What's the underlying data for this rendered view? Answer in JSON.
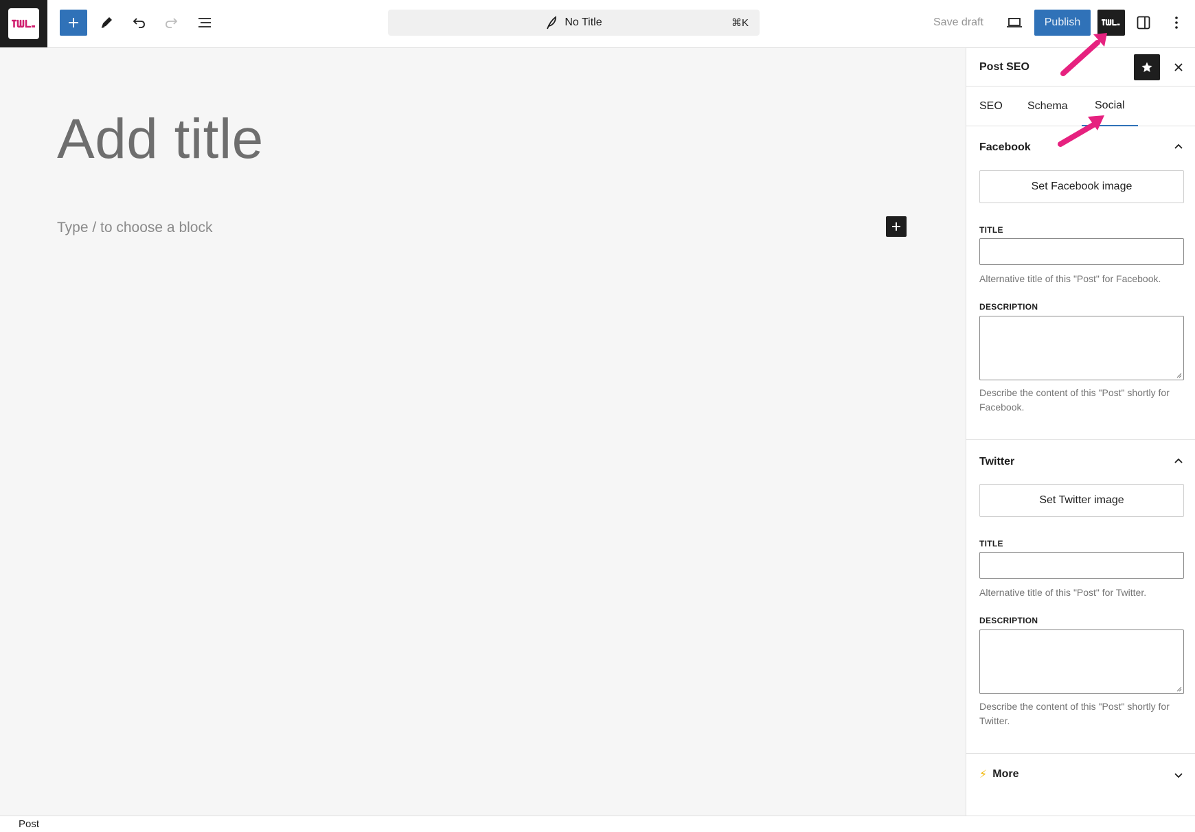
{
  "toolbar": {
    "document_title": "No Title",
    "command_shortcut": "⌘K",
    "save_draft_label": "Save draft",
    "publish_label": "Publish",
    "accent_color": "#3072b8",
    "icons": {
      "logo": "site-logo-icon",
      "add": "plus-icon",
      "tools": "pencil-icon",
      "undo": "undo-icon",
      "redo": "redo-icon",
      "outline": "list-view-icon",
      "view": "laptop-icon",
      "plugin": "seo-plugin-icon",
      "sidebar": "sidebar-icon",
      "options": "more-vertical-icon"
    }
  },
  "editor": {
    "title_placeholder": "Add title",
    "block_placeholder": "Type / to choose a block"
  },
  "sidebar": {
    "title": "Post SEO",
    "tabs": [
      {
        "label": "SEO",
        "active": false
      },
      {
        "label": "Schema",
        "active": false
      },
      {
        "label": "Social",
        "active": true
      }
    ],
    "facebook": {
      "heading": "Facebook",
      "set_image_label": "Set Facebook image",
      "title_label": "TITLE",
      "title_value": "",
      "title_help": "Alternative title of this \"Post\" for Facebook.",
      "description_label": "DESCRIPTION",
      "description_value": "",
      "description_help": "Describe the content of this \"Post\" shortly for Facebook."
    },
    "twitter": {
      "heading": "Twitter",
      "set_image_label": "Set Twitter image",
      "title_label": "TITLE",
      "title_value": "",
      "title_help": "Alternative title of this \"Post\" for Twitter.",
      "description_label": "DESCRIPTION",
      "description_value": "",
      "description_help": "Describe the content of this \"Post\" shortly for Twitter."
    },
    "more": {
      "label": "More",
      "icon": "⚡"
    }
  },
  "footer": {
    "breadcrumb": "Post"
  },
  "annotation_color": "#e6217f"
}
